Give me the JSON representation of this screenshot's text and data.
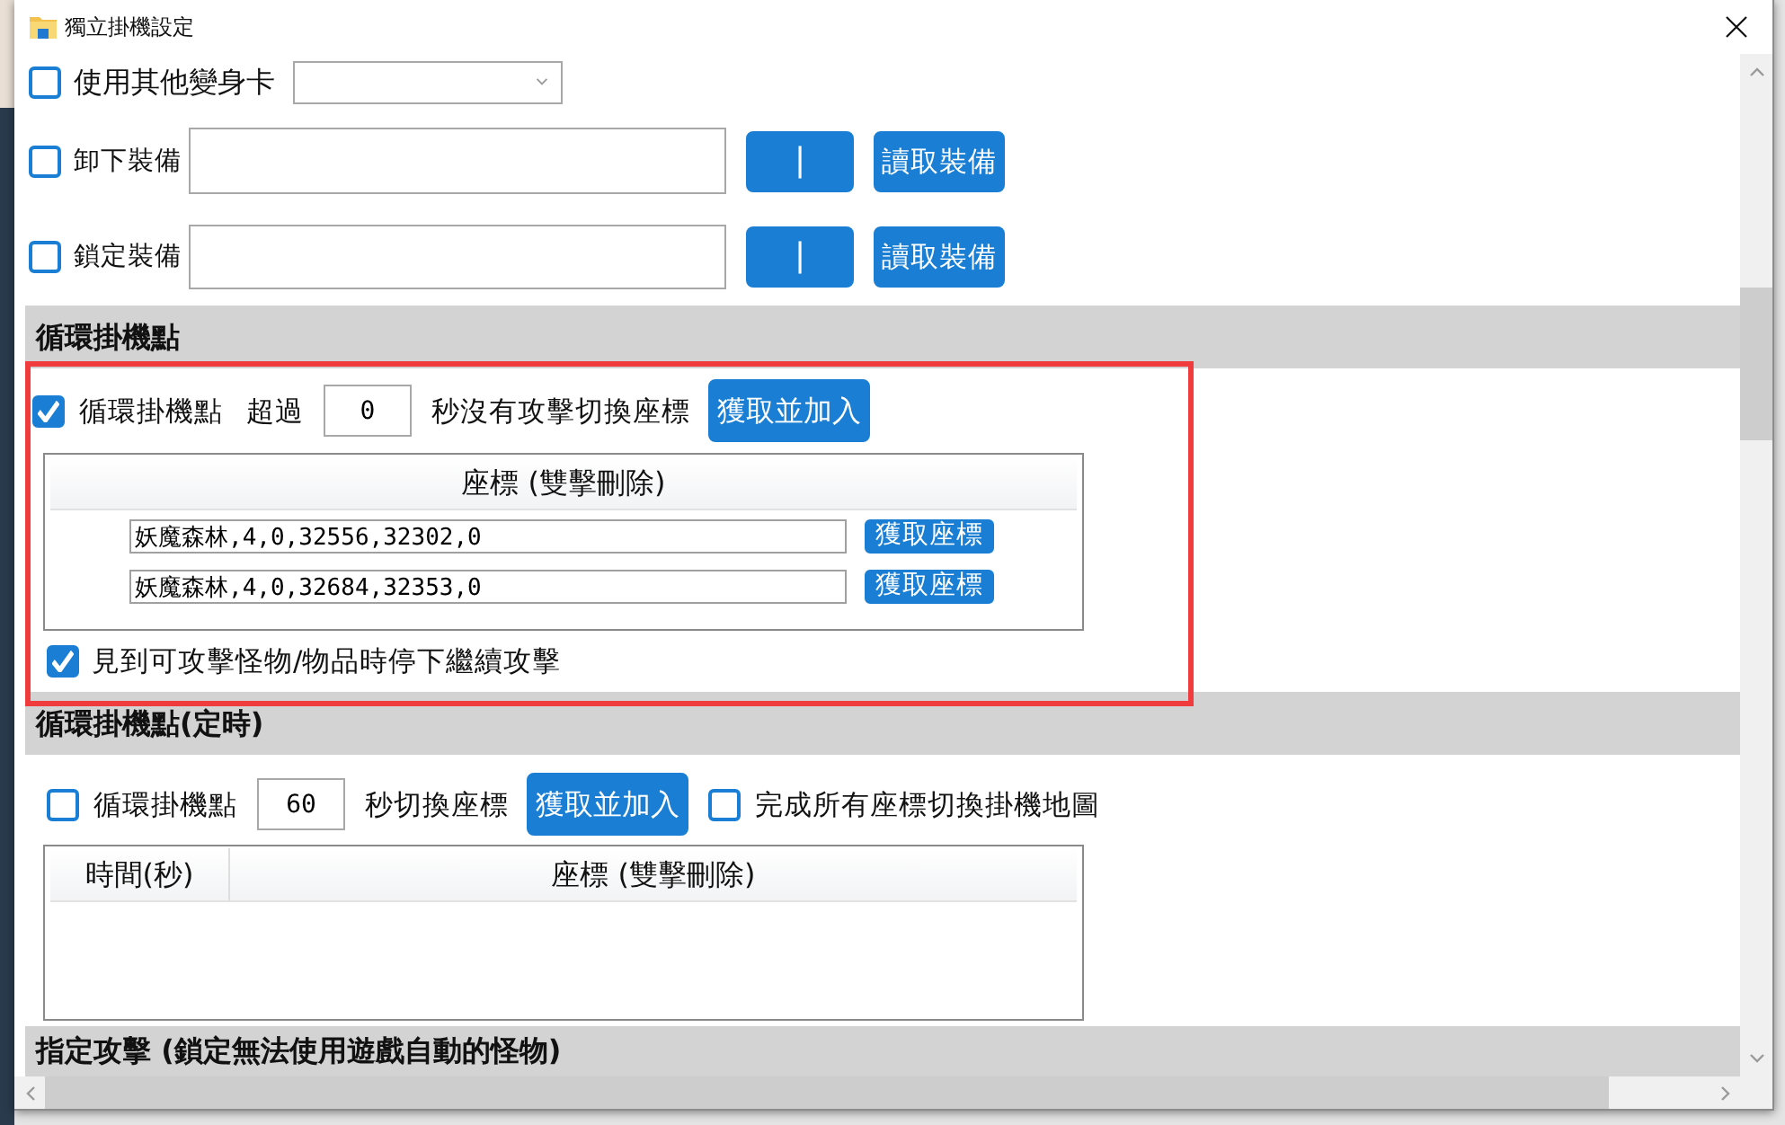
{
  "window": {
    "title": "獨立掛機設定"
  },
  "top_rows": [
    {
      "kind": "select",
      "label": "使用其他變身卡",
      "checked": false
    },
    {
      "kind": "equipment",
      "label": "卸下裝備",
      "checked": false,
      "buttons": [
        "|",
        "讀取裝備"
      ]
    },
    {
      "kind": "equipment",
      "label": "鎖定裝備",
      "checked": false,
      "buttons": [
        "|",
        "讀取裝備"
      ]
    }
  ],
  "sections": [
    {
      "kind": "loop",
      "title": "循環掛機點",
      "highlighted": true,
      "enable": {
        "label": "循環掛機點",
        "checked": true
      },
      "prefix": "超過",
      "seconds": "0",
      "suffix": "秒沒有攻擊切換座標",
      "add_button": "獲取並加入",
      "table": {
        "columns": [
          "座標 (雙擊刪除)"
        ],
        "rows": [
          {
            "coordinate": "妖魔森林,4,0,32556,32302,0",
            "button": "獲取座標"
          },
          {
            "coordinate": "妖魔森林,4,0,32684,32353,0",
            "button": "獲取座標"
          }
        ]
      },
      "stop_option": {
        "label": "見到可攻擊怪物/物品時停下繼續攻擊",
        "checked": true
      }
    },
    {
      "kind": "timed",
      "title": "循環掛機點(定時)",
      "highlighted": false,
      "enable": {
        "label": "循環掛機點",
        "checked": false
      },
      "seconds": "60",
      "suffix": "秒切換座標",
      "add_button": "獲取並加入",
      "switch_map": {
        "label": "完成所有座標切換掛機地圖",
        "checked": false
      },
      "table": {
        "columns": [
          "時間(秒)",
          "座標 (雙擊刪除)"
        ]
      }
    },
    {
      "kind": "target",
      "title": "指定攻擊 (鎖定無法使用遊戲自動的怪物)",
      "highlighted": false
    }
  ]
}
